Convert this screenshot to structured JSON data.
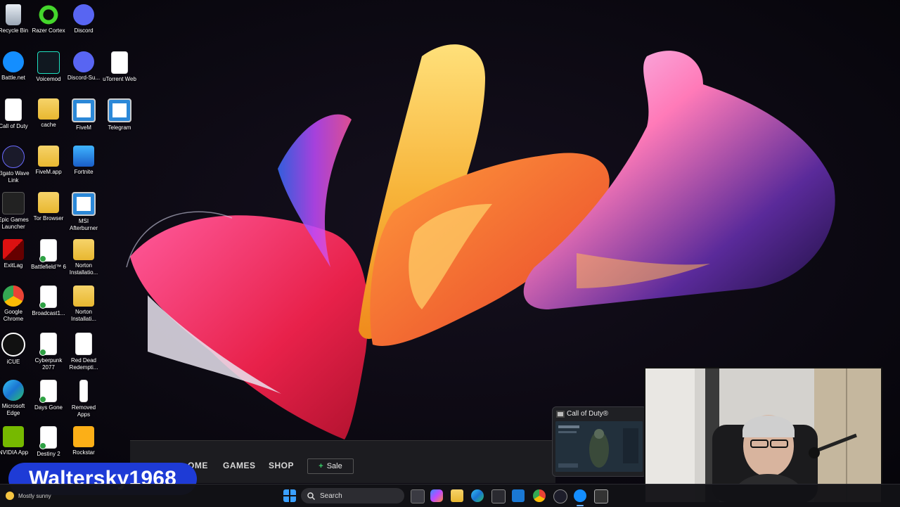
{
  "desktop": {
    "icons": [
      {
        "label": "Recycle Bin",
        "icon": "recycle-bin-icon"
      },
      {
        "label": "Razer Cortex",
        "icon": "razer-cortex-icon"
      },
      {
        "label": "Discord",
        "icon": "discord-icon"
      },
      {
        "label": "Battle.net",
        "icon": "battlenet-icon"
      },
      {
        "label": "Voicemod",
        "icon": "voicemod-icon"
      },
      {
        "label": "Discord-Su...",
        "icon": "discord-icon"
      },
      {
        "label": "uTorrent Web",
        "icon": "document-icon"
      },
      {
        "label": "Call of Duty",
        "icon": "document-icon"
      },
      {
        "label": "cache",
        "icon": "folder-icon"
      },
      {
        "label": "FiveM",
        "icon": "fivem-icon"
      },
      {
        "label": "Telegram",
        "icon": "telegram-icon"
      },
      {
        "label": "Elgato Wave Link",
        "icon": "wavelink-icon"
      },
      {
        "label": "FiveM.app",
        "icon": "folder-icon"
      },
      {
        "label": "Fortnite",
        "icon": "fortnite-icon"
      },
      {
        "label": "Epic Games Launcher",
        "icon": "epic-games-icon"
      },
      {
        "label": "Tor Browser",
        "icon": "folder-icon"
      },
      {
        "label": "MSI Afterburner",
        "icon": "msi-icon"
      },
      {
        "label": "ExitLag",
        "icon": "exitlag-icon"
      },
      {
        "label": "Battlefield™ 6",
        "icon": "document-icon"
      },
      {
        "label": "Norton Installatio...",
        "icon": "folder-icon"
      },
      {
        "label": "Google Chrome",
        "icon": "chrome-icon"
      },
      {
        "label": "Broadcast1...",
        "icon": "document-icon"
      },
      {
        "label": "Norton Installati...",
        "icon": "folder-icon"
      },
      {
        "label": "iCUE",
        "icon": "icue-icon"
      },
      {
        "label": "Cyberpunk 2077",
        "icon": "document-icon"
      },
      {
        "label": "Red Dead Redempti...",
        "icon": "document-icon"
      },
      {
        "label": "Microsoft Edge",
        "icon": "edge-icon"
      },
      {
        "label": "Days Gone",
        "icon": "document-icon"
      },
      {
        "label": "Removed Apps",
        "icon": "document-icon"
      },
      {
        "label": "NVIDIA App",
        "icon": "nvidia-icon"
      },
      {
        "label": "Destiny 2",
        "icon": "document-icon"
      },
      {
        "label": "Rockstar",
        "icon": "rockstar-icon"
      }
    ]
  },
  "launcher_bar": {
    "nav": [
      "OME",
      "GAMES",
      "SHOP"
    ],
    "sale_label": "Sale"
  },
  "watermark": {
    "text": "Waltersky1968"
  },
  "taskbar": {
    "weather": "Mostly sunny",
    "search_placeholder": "Search",
    "icons": [
      "start-icon",
      "search-icon",
      "task-view-icon",
      "copilot-icon",
      "file-explorer-icon",
      "edge-icon",
      "store-icon",
      "mail-icon",
      "chrome-icon",
      "app-icon",
      "battlenet-icon",
      "cod-icon"
    ]
  },
  "thumbnail": {
    "title": "Call of Duty®"
  },
  "colors": {
    "watermark_bg": "#1e3bd6",
    "taskbar_bg": "#121216",
    "sale_accent": "#38d16a"
  }
}
